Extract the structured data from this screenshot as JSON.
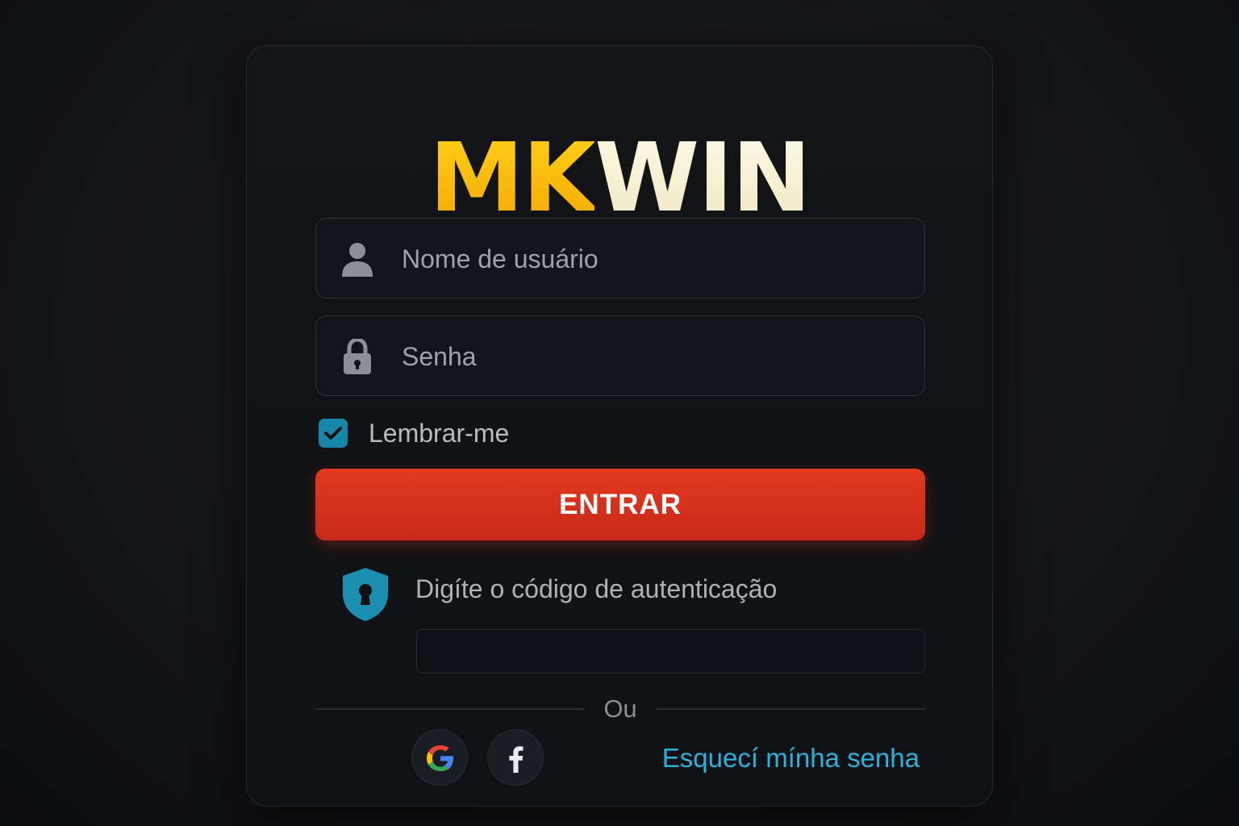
{
  "brand": {
    "logo_part1": "MK",
    "logo_part2": "WIN",
    "colors": {
      "gold": "#ffc81a",
      "cream": "#f5efd6",
      "accent": "#1687a8",
      "button": "#d8321d",
      "link": "#2bb2da"
    }
  },
  "login": {
    "username_placeholder": "Nome de usuário",
    "password_placeholder": "Senha",
    "username_icon": "user-icon",
    "password_icon": "lock-icon",
    "remember_label": "Lembrar-me",
    "remember_checked": true,
    "submit_label": "ENTRAR"
  },
  "auth": {
    "icon": "shield-keyhole-icon",
    "label": "Digíte o código de autenticação",
    "code_value": ""
  },
  "alt": {
    "divider_label": "Ou",
    "google_icon": "google-icon",
    "facebook_icon": "facebook-icon",
    "forgot_link": "Esquecí mínha senha"
  }
}
